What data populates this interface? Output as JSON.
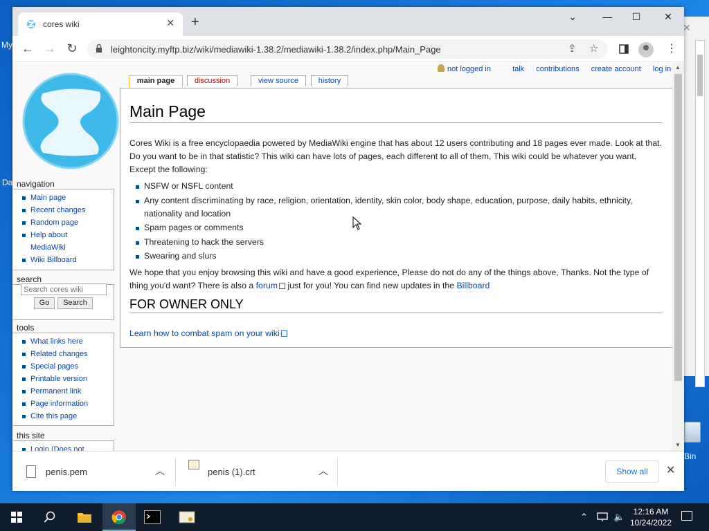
{
  "desktop": {
    "fragments": [
      "My",
      "Da",
      "Bin"
    ]
  },
  "browser": {
    "tab_title": "cores wiki",
    "new_tab_symbol": "+",
    "url": "leightoncity.myftp.biz/wiki/mediawiki-1.38.2/mediawiki-1.38.2/index.php/Main_Page",
    "icons": {
      "back": "arrow-left-icon",
      "forward": "arrow-right-icon",
      "reload": "reload-icon",
      "lock": "lock-icon",
      "share": "share-icon",
      "bookmark": "star-icon",
      "side_panel": "side-panel-icon",
      "profile": "profile-icon",
      "menu": "kebab-menu-icon"
    }
  },
  "wiki": {
    "top_links": [
      "not logged in",
      "talk",
      "contributions",
      "create account",
      "log in"
    ],
    "tabs": [
      "main page",
      "discussion",
      "view source",
      "history"
    ],
    "title": "Main Page",
    "intro": "Cores Wiki is a free encyclopaedia powered by MediaWiki engine that has about 12 users contributing and 18 pages ever made. Look at that. Do you want to be in that statistic? This wiki can have lots of pages, each different to all of them, This wiki could be whatever you want, Except the following:",
    "rules": [
      "NSFW or NSFL content",
      "Any content discriminating by race, religion, orientation, identity, skin color, body shape, education, purpose, daily habits, ethnicity, nationality and location",
      "Spam pages or comments",
      "Threatening to hack the servers",
      "Swearing and slurs"
    ],
    "outro_a": "We hope that you enjoy browsing this wiki and have a good experience, Please do not do any of the things above, Thanks. Not the type of thing you'd want? There is also a ",
    "forum_link": "forum",
    "outro_b": " just for you! You can find new updates in the ",
    "billboard_link": "Billboard",
    "section2_title": "FOR OWNER ONLY",
    "spam_link": "Learn how to combat spam on your wiki"
  },
  "sidebar": {
    "navigation": {
      "heading": "navigation",
      "items": [
        "Main page",
        "Recent changes",
        "Random page",
        "Help about MediaWiki",
        "Wiki Billboard"
      ]
    },
    "search": {
      "heading": "search",
      "placeholder": "Search cores wiki",
      "go_label": "Go",
      "search_label": "Search"
    },
    "tools": {
      "heading": "tools",
      "items": [
        "What links here",
        "Related changes",
        "Special pages",
        "Printable version",
        "Permanent link",
        "Page information",
        "Cite this page"
      ]
    },
    "this_site": {
      "heading": "this site",
      "items": [
        "Login (Does not"
      ]
    }
  },
  "downloads": {
    "items": [
      "penis.pem",
      "penis (1).crt"
    ],
    "show_all": "Show all"
  },
  "taskbar": {
    "time": "12:16 AM",
    "date": "10/24/2022"
  }
}
